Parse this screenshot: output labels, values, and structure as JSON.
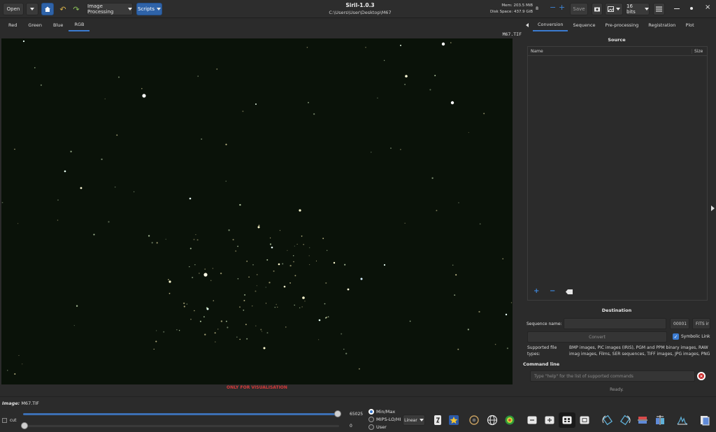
{
  "header": {
    "open_label": "Open",
    "image_processing_label": "Image Processing",
    "scripts_label": "Scripts",
    "title": "Siril-1.0.3",
    "path": "C:\\Users\\User\\Desktop\\M67",
    "mem": "Mem: 203.5 MiB",
    "disk": "Disk Space: 437.9 GiB",
    "threads": "8",
    "save_label": "Save",
    "bits_label": "16 bits"
  },
  "channels": {
    "tabs": [
      "Red",
      "Green",
      "Blue",
      "RGB"
    ],
    "active": "RGB"
  },
  "viewer": {
    "filename": "M67.TIF",
    "notice": "ONLY FOR VISUALISATION"
  },
  "panel": {
    "tabs": [
      "Conversion",
      "Sequence",
      "Pre-processing",
      "Registration",
      "Plot"
    ],
    "active": "Conversion",
    "source_title": "Source",
    "col_name": "Name",
    "col_size": "Size",
    "destination_title": "Destination",
    "sequence_name_label": "Sequence name:",
    "index_value": "00001",
    "format_value": "FITS ir",
    "convert_label": "Convert",
    "symbolic_link_label": "Symbolic Link",
    "supported_label": "Supported file types:",
    "supported_text": "BMP images, PIC images (IRIS), PGM and PPM binary images, RAW imag images, Films, SER sequences, TIFF images, JPG images, PNG images, HE",
    "command_line_label": "Command line",
    "command_placeholder": "Type \"help\" for the list of supported commands",
    "status": "Ready."
  },
  "bottom": {
    "image_label": "Image:",
    "image_name": "M67.TIF",
    "cut_label": "cut",
    "high_value": "65025",
    "low_value": "0",
    "modes": [
      "Min/Max",
      "MIPS-LO/HI",
      "User"
    ],
    "selected_mode": "Min/Max",
    "scale_label": "Linear",
    "high_slider_level": 1.0,
    "low_slider_level": 0.0
  },
  "colors": {
    "accent": "#2f63a8",
    "background": "#2b2b2b",
    "sky": "#0a1209",
    "warning": "#d73b3b"
  }
}
